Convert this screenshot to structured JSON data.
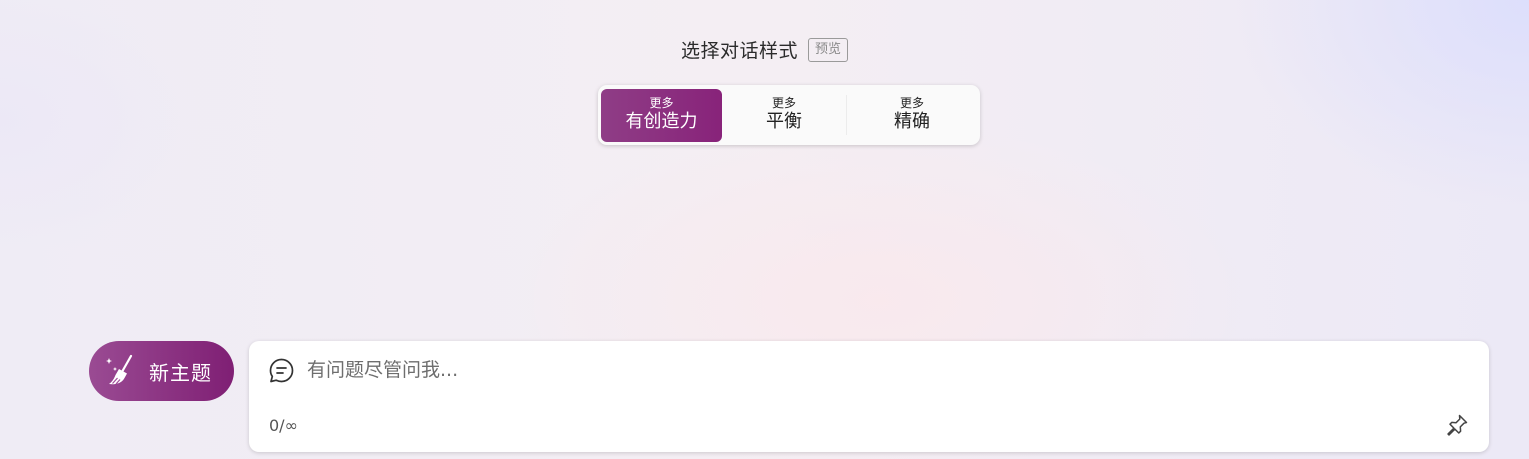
{
  "header": {
    "title": "选择对话样式",
    "badge": "预览"
  },
  "style_selector": {
    "selected_index": 0,
    "options": [
      {
        "more": "更多",
        "name": "有创造力"
      },
      {
        "more": "更多",
        "name": "平衡"
      },
      {
        "more": "更多",
        "name": "精确"
      }
    ]
  },
  "new_topic": {
    "label": "新主题",
    "icon": "broom-icon"
  },
  "chat_input": {
    "placeholder": "有问题尽管问我...",
    "value": "",
    "char_count": "0/∞",
    "icon": "chat-bubble-icon",
    "pin_icon": "pin-icon"
  },
  "colors": {
    "accent_start": "#8f3d86",
    "accent_end": "#88237a"
  }
}
